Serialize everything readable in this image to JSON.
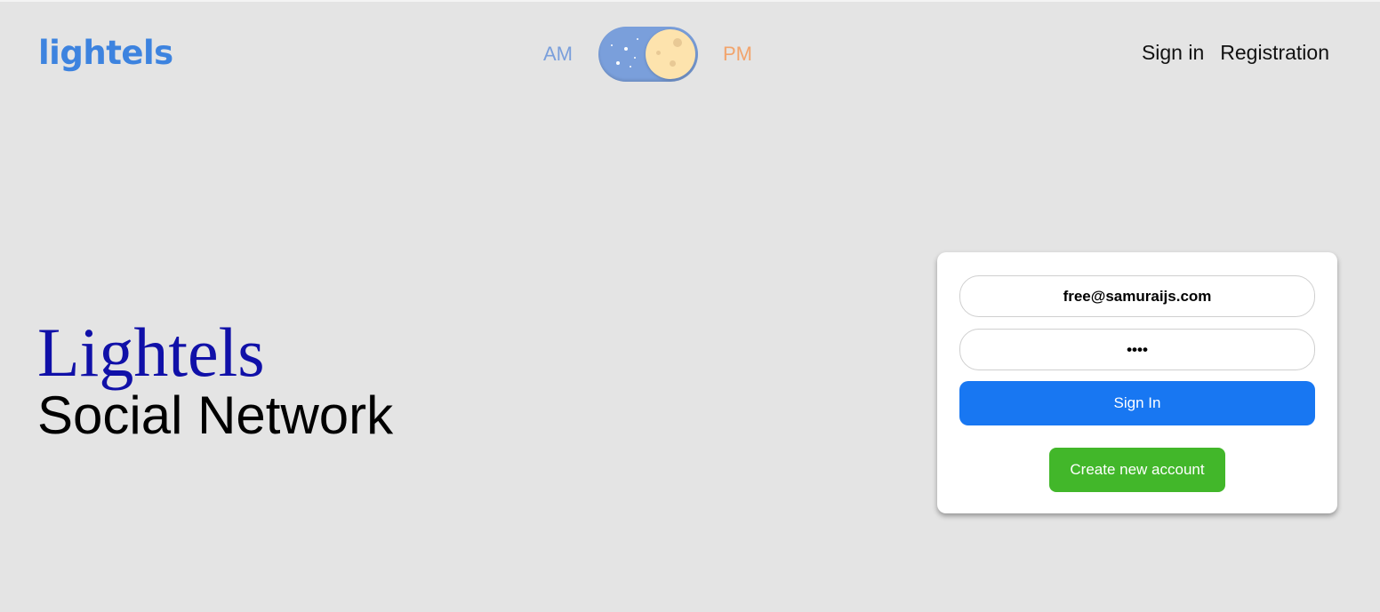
{
  "header": {
    "logo": "lightels",
    "theme_toggle": {
      "am_label": "AM",
      "pm_label": "PM",
      "state": "night",
      "icon": "moon-icon"
    },
    "nav": {
      "sign_in": "Sign in",
      "registration": "Registration"
    }
  },
  "hero": {
    "title": "Lightels",
    "subtitle": "Social Network"
  },
  "login_form": {
    "email_value": "free@samuraijs.com",
    "password_value": "free",
    "sign_in_button": "Sign In",
    "create_account_button": "Create new account"
  },
  "colors": {
    "background": "#e4e4e4",
    "logo": "#3d83df",
    "am": "#7a9fdb",
    "pm": "#f2a46c",
    "hero_title": "#1010a8",
    "primary_button": "#1877f2",
    "secondary_button": "#42b72a"
  }
}
